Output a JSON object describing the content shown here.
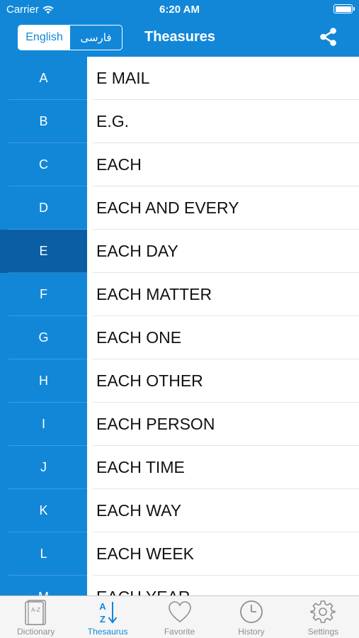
{
  "status_bar": {
    "carrier": "Carrier",
    "time": "6:20 AM"
  },
  "nav": {
    "languages": [
      "English",
      "فارسی"
    ],
    "active_language": "English",
    "title": "Theasures",
    "share_icon": "share-icon"
  },
  "index": {
    "letters": [
      "A",
      "B",
      "C",
      "D",
      "E",
      "F",
      "G",
      "H",
      "I",
      "J",
      "K",
      "L",
      "M"
    ],
    "selected": "E"
  },
  "words": [
    "E MAIL",
    "E.G.",
    "EACH",
    "EACH AND EVERY",
    "EACH DAY",
    "EACH MATTER",
    "EACH ONE",
    "EACH OTHER",
    "EACH PERSON",
    "EACH TIME",
    "EACH WAY",
    "EACH WEEK",
    "EACH YEAR"
  ],
  "tabbar": {
    "active": "Thesaurus",
    "tabs": [
      {
        "label": "Dictionary",
        "icon": "dictionary-icon"
      },
      {
        "label": "Thesaurus",
        "icon": "thesaurus-az-icon"
      },
      {
        "label": "Favorite",
        "icon": "heart-icon"
      },
      {
        "label": "History",
        "icon": "clock-icon"
      },
      {
        "label": "Settings",
        "icon": "gear-icon"
      }
    ]
  },
  "colors": {
    "primary": "#1287d8",
    "index_selected": "#0b5ea3",
    "tab_inactive": "#8f8f8f",
    "tabbar_bg": "#f5f5f5"
  }
}
